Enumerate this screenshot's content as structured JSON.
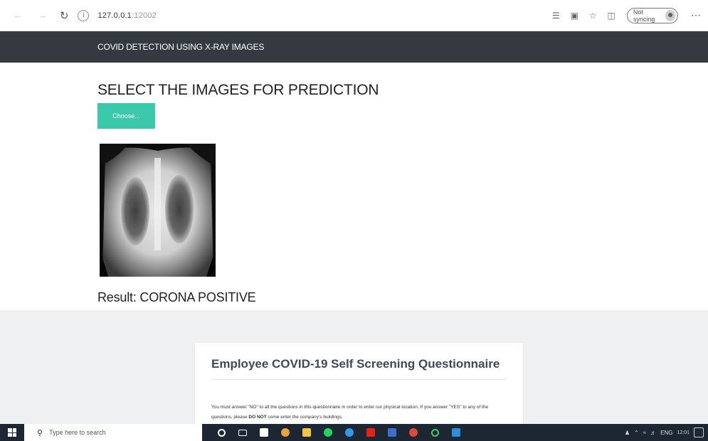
{
  "browser": {
    "url_host": "127.0.0.1",
    "url_port": ":12002",
    "profile_label": "Not syncing"
  },
  "navbar": {
    "brand": "COVID DETECTION USING X-RAY IMAGES"
  },
  "main": {
    "heading": "SELECT THE IMAGES FOR PREDICTION",
    "choose_button": "Choose...",
    "result": "Result: CORONA POSITIVE"
  },
  "questionnaire": {
    "title": "Employee COVID-19 Self Screening Questionnaire",
    "text_part1": "You must answer \"NO\" to all the questions in this questionnaire in order to enter our physical location. If you answer \"YES\" to any of the questions, please ",
    "text_bold": "DO NOT",
    "text_part2": " come enter the company's buildings."
  },
  "taskbar": {
    "search_placeholder": "Type here to search",
    "time": "12:01",
    "language": "ENG"
  },
  "colors": {
    "navbar_bg": "#343a40",
    "choose_button_bg": "#3cc8aa",
    "lower_bg": "#eff0f1",
    "taskbar_bg": "#1c2733"
  }
}
